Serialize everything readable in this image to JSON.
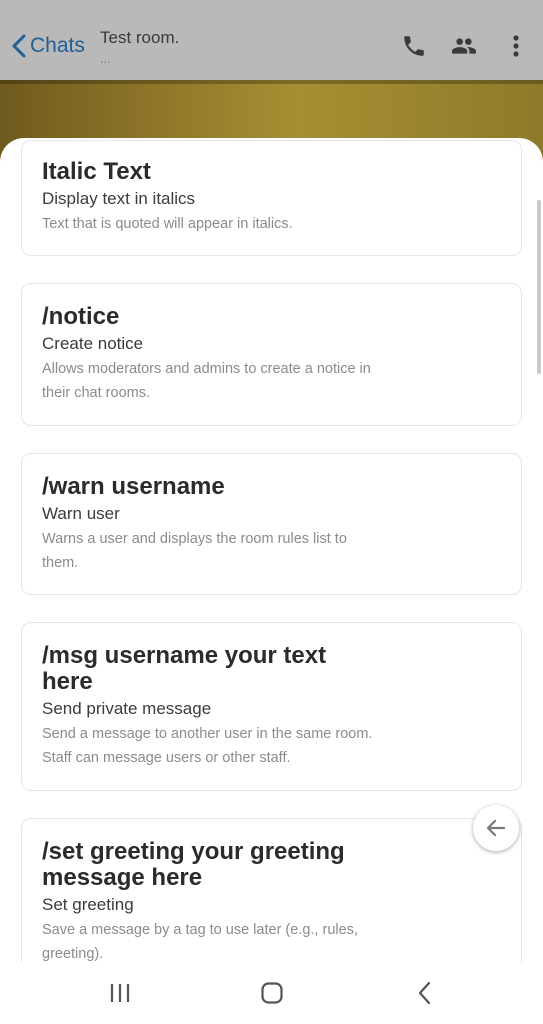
{
  "header": {
    "back_label": "Chats",
    "room_title": "Test room.",
    "room_subtitle": "..."
  },
  "commands": [
    {
      "command": "Italic Text",
      "title": "Display text in italics",
      "description": "Text that is quoted will appear in italics."
    },
    {
      "command": "/notice",
      "title": "Create notice",
      "description_lines": [
        "Allows moderators and admins to create a notice in",
        "their chat rooms."
      ]
    },
    {
      "command": "/warn username",
      "title": "Warn user",
      "description_lines": [
        "Warns a user and displays the room rules list to",
        "them."
      ]
    },
    {
      "command_lines": [
        "/msg username your text",
        "here"
      ],
      "title": "Send private message",
      "description_lines": [
        "Send a message to another user in the same room.",
        "Staff can message users or other staff."
      ]
    },
    {
      "command_lines": [
        "/set greeting your greeting",
        "message here"
      ],
      "title": "Set greeting",
      "description_lines": [
        "Save a message by a tag to use later (e.g., rules,",
        "greeting)."
      ]
    }
  ],
  "colors": {
    "accent": "#1f5f94",
    "overlay": "#b9b9b9",
    "card_border": "#e6e6e6"
  },
  "icons": {
    "back": "chevron-left-icon",
    "call": "phone-icon",
    "members": "people-icon",
    "menu": "more-vertical-icon",
    "fab": "arrow-left-icon",
    "nav_recents": "recents-icon",
    "nav_home": "home-icon",
    "nav_back": "nav-back-icon"
  }
}
